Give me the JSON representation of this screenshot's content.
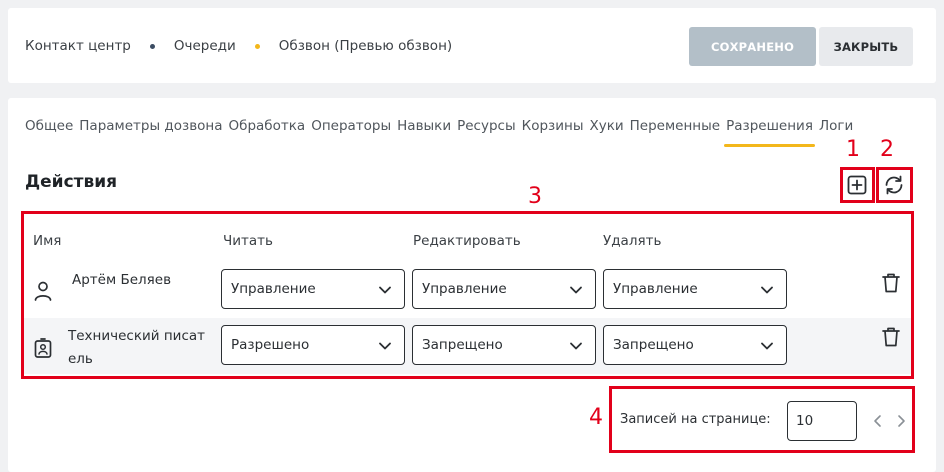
{
  "breadcrumbs": [
    {
      "label": "Контакт центр",
      "dot_color": "#3b4c63"
    },
    {
      "label": "Очереди",
      "dot_color": "#f3b71b"
    },
    {
      "label": "Обзвон (Превью обзвон)"
    }
  ],
  "header": {
    "saved_label": "СОХРАНЕНО",
    "close_label": "ЗАКРЫТЬ"
  },
  "tabs": [
    {
      "label": "Общее"
    },
    {
      "label": "Параметры дозвона"
    },
    {
      "label": "Обработка"
    },
    {
      "label": "Операторы"
    },
    {
      "label": "Навыки"
    },
    {
      "label": "Ресурсы"
    },
    {
      "label": "Корзины"
    },
    {
      "label": "Хуки"
    },
    {
      "label": "Переменные"
    },
    {
      "label": "Разрешения",
      "active": true
    },
    {
      "label": "Логи"
    }
  ],
  "section": {
    "title": "Действия",
    "add_icon": "plus-square-icon",
    "refresh_icon": "refresh-icon"
  },
  "annotations": [
    "1",
    "2",
    "3",
    "4"
  ],
  "table": {
    "columns": [
      "Имя",
      "Читать",
      "Редактировать",
      "Удалять"
    ],
    "rows": [
      {
        "icon": "user-icon",
        "name": "Артём Беляев",
        "read": "Управление",
        "edit": "Управление",
        "delete": "Управление"
      },
      {
        "icon": "badge-icon",
        "name_line1": "Технический писат",
        "name_line2": "ель",
        "read": "Разрешено",
        "edit": "Запрещено",
        "delete": "Запрещено"
      }
    ]
  },
  "pagination": {
    "label": "Записей на странице:",
    "per_page": "10"
  },
  "colors": {
    "accent": "#f3b71b",
    "annotation": "#e2001a",
    "saved_button": "#b3bfc8"
  }
}
